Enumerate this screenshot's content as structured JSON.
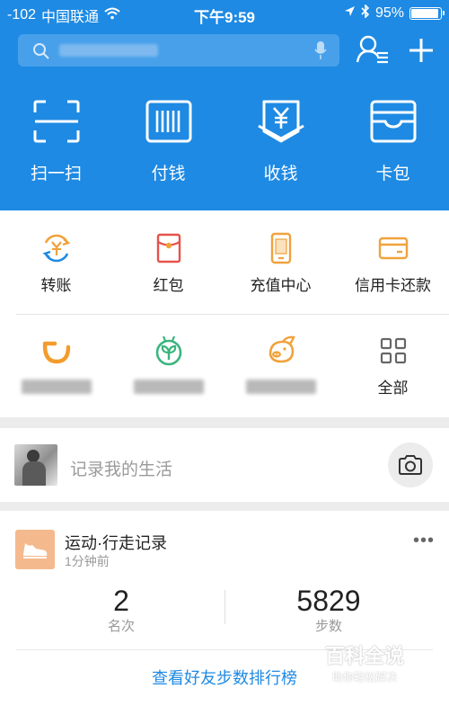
{
  "status_bar": {
    "signal": "-102",
    "carrier": "中国联通",
    "time": "下午9:59",
    "battery_text": "95%",
    "battery_level": 0.95
  },
  "header": {
    "search_placeholder": "",
    "colors": {
      "header_bg": "#1e8ae3",
      "search_bg": "#48a0ea"
    }
  },
  "primary_actions": [
    {
      "label": "扫一扫",
      "icon": "scan-icon"
    },
    {
      "label": "付钱",
      "icon": "barcode-icon"
    },
    {
      "label": "收钱",
      "icon": "yuan-receive-icon"
    },
    {
      "label": "卡包",
      "icon": "card-wallet-icon"
    }
  ],
  "services_row1": [
    {
      "label": "转账",
      "icon": "transfer-icon",
      "color": "#f0a23b"
    },
    {
      "label": "红包",
      "icon": "red-packet-icon",
      "color": "#e5534b"
    },
    {
      "label": "充值中心",
      "icon": "phone-topup-icon",
      "color": "#f0a23b"
    },
    {
      "label": "信用卡还款",
      "icon": "credit-card-icon",
      "color": "#f0a23b"
    }
  ],
  "services_row2": [
    {
      "label": "",
      "icon": "didi-icon",
      "color": "#f39c2c"
    },
    {
      "label": "",
      "icon": "sprout-icon",
      "color": "#3bb57e"
    },
    {
      "label": "",
      "icon": "pig-icon",
      "color": "#f0a23b"
    },
    {
      "label": "全部",
      "icon": "grid-icon",
      "color": "#666666"
    }
  ],
  "life_card": {
    "placeholder": "记录我的生活",
    "camera_icon": "camera-icon"
  },
  "sport_card": {
    "title": "运动·行走记录",
    "time_ago": "1分钟前",
    "rank_value": "2",
    "rank_caption": "名次",
    "steps_value": "5829",
    "steps_caption": "步数",
    "leaderboard_link": "查看好友步数排行榜",
    "icon": "shoe-icon",
    "icon_bg": "#f5b98e"
  },
  "watermark": {
    "title": "百科全说",
    "subtitle": "助你轻松解决"
  }
}
